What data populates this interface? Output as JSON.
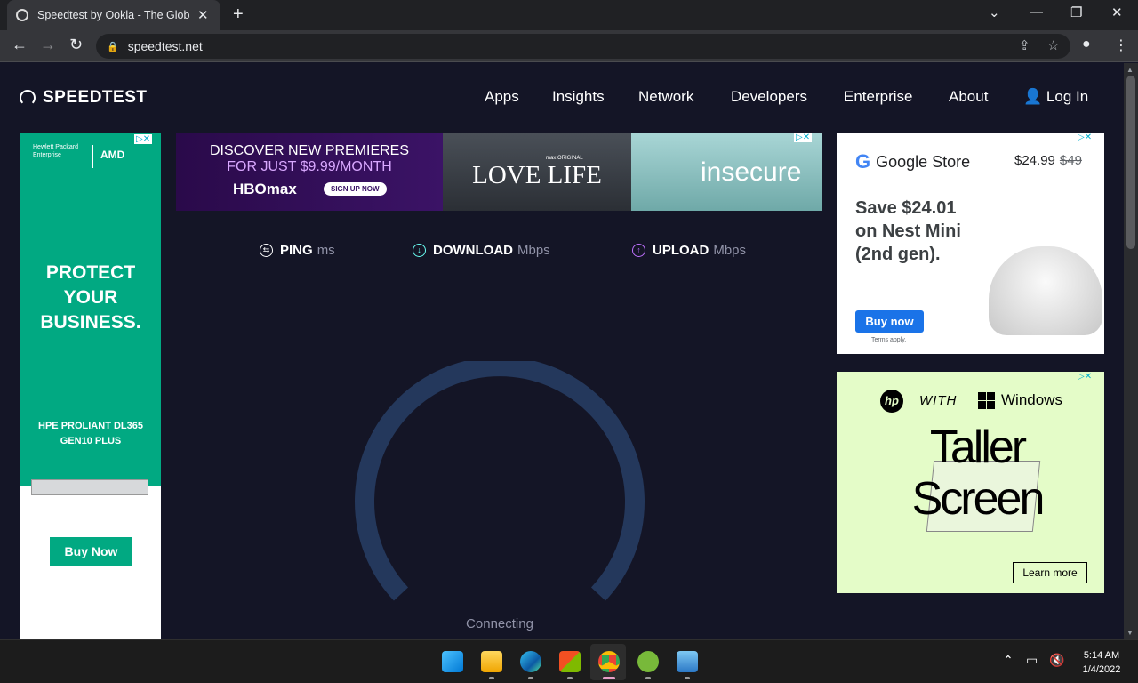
{
  "browser": {
    "tab_title": "Speedtest by Ookla - The Global",
    "tab_close": "✕",
    "new_tab": "+",
    "url": "speedtest.net",
    "window_controls": {
      "dropdown": "⌄",
      "minimize": "—",
      "restore": "❐",
      "close": "✕"
    }
  },
  "site": {
    "logo_text": "SPEEDTEST",
    "menu": [
      "Apps",
      "Insights",
      "Network",
      "Developers",
      "Enterprise",
      "About"
    ],
    "login": "Log In"
  },
  "ad_left": {
    "brand1": "Hewlett Packard Enterprise",
    "brand2": "AMD",
    "headline": "PROTECT YOUR BUSINESS.",
    "model": "HPE PROLIANT DL365 GEN10 PLUS",
    "cta": "Buy Now",
    "color": "#01a982"
  },
  "ad_banner": {
    "line1": "DISCOVER NEW PREMIERES",
    "line2": "FOR JUST $9.99/MONTH",
    "brand": "HBOmax",
    "cta": "SIGN UP NOW",
    "original": "max ORIGINAL",
    "show1": "LOVE LIFE",
    "show2": "insecure"
  },
  "stats": {
    "ping": {
      "label": "PING",
      "unit": "ms",
      "color": "#ffffff"
    },
    "download": {
      "label": "DOWNLOAD",
      "unit": "Mbps",
      "color": "#6afff3"
    },
    "upload": {
      "label": "UPLOAD",
      "unit": "Mbps",
      "color": "#bf71ff"
    }
  },
  "gauge": {
    "status": "Connecting",
    "color": "#24385c"
  },
  "ad_right1": {
    "brand": "Google Store",
    "price": "$24.99",
    "old_price": "$49",
    "headline": "Save $24.01 on Nest Mini (2nd gen).",
    "cta": "Buy now",
    "terms": "Terms apply."
  },
  "ad_right2": {
    "brand": "hp",
    "with": "WITH",
    "windows": "Windows",
    "headline": "Taller Screen",
    "cta": "Learn more"
  },
  "taskbar": {
    "time": "5:14 AM",
    "date": "1/4/2022",
    "apps": [
      "windows-start-icon",
      "file-explorer-icon",
      "edge-icon",
      "store-icon",
      "chrome-icon",
      "utorrent-icon",
      "photos-icon"
    ]
  }
}
